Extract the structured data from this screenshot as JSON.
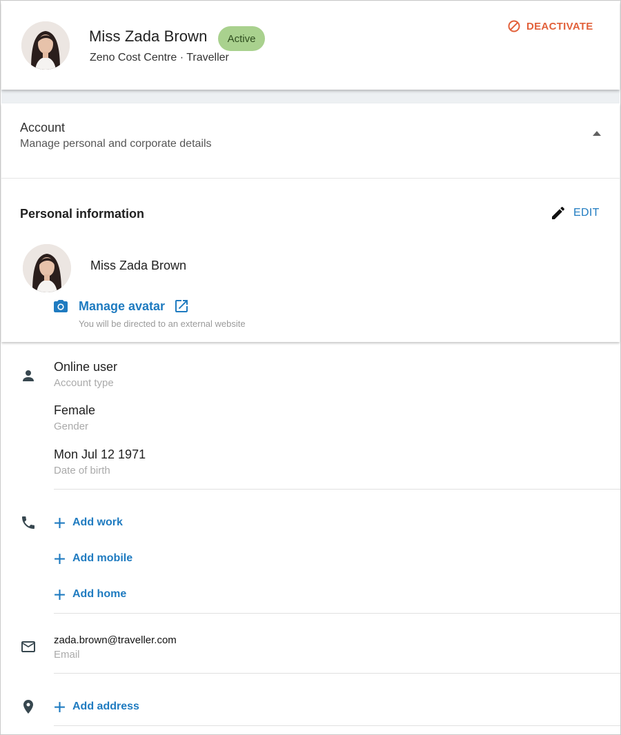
{
  "header": {
    "name": "Miss Zada Brown",
    "status": "Active",
    "subtitle": "Zeno Cost Centre · Traveller",
    "deactivate_label": "DEACTIVATE"
  },
  "account": {
    "title": "Account",
    "subtitle": "Manage personal and corporate details"
  },
  "personal_info": {
    "title": "Personal information",
    "edit_label": "EDIT",
    "name": "Miss Zada Brown",
    "manage_avatar_label": "Manage avatar",
    "external_note": "You will be directed to an external website"
  },
  "details": {
    "account_type": {
      "value": "Online user",
      "label": "Account type"
    },
    "gender": {
      "value": "Female",
      "label": "Gender"
    },
    "dob": {
      "value": "Mon Jul 12 1971",
      "label": "Date of birth"
    },
    "phones": [
      "Add work",
      "Add mobile",
      "Add home"
    ],
    "email": {
      "value": "zada.brown@traveller.com",
      "label": "Email"
    },
    "address_label": "Add address"
  },
  "colors": {
    "accent": "#1f7bc0",
    "danger": "#e2603a",
    "status_bg": "#a9d18e"
  },
  "icons": [
    "person-icon",
    "phone-icon",
    "mail-icon",
    "location-icon",
    "camera-icon",
    "external-link-icon",
    "pencil-icon",
    "block-icon",
    "plus-icon",
    "caret-up-icon"
  ]
}
